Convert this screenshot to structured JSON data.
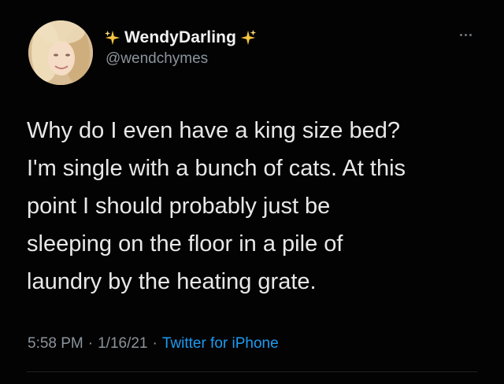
{
  "author": {
    "display_name": "WendyDarling",
    "handle": "@wendchymes",
    "avatar_icon": "profile-photo",
    "name_decoration_icon": "sparkles-icon"
  },
  "tweet": {
    "text": "Why do I even have a king size bed?\nI'm single with a bunch of cats. At this\npoint I should probably just be\nsleeping on the floor in a pile of\nlaundry by the heating grate."
  },
  "meta": {
    "time": "5:58 PM",
    "date": "1/16/21",
    "separator": "·",
    "source": "Twitter for iPhone"
  },
  "colors": {
    "background": "#030303",
    "text": "#e8e8e8",
    "muted": "#8b949c",
    "link": "#1d9bf0",
    "sparkle": "#f5c542"
  }
}
